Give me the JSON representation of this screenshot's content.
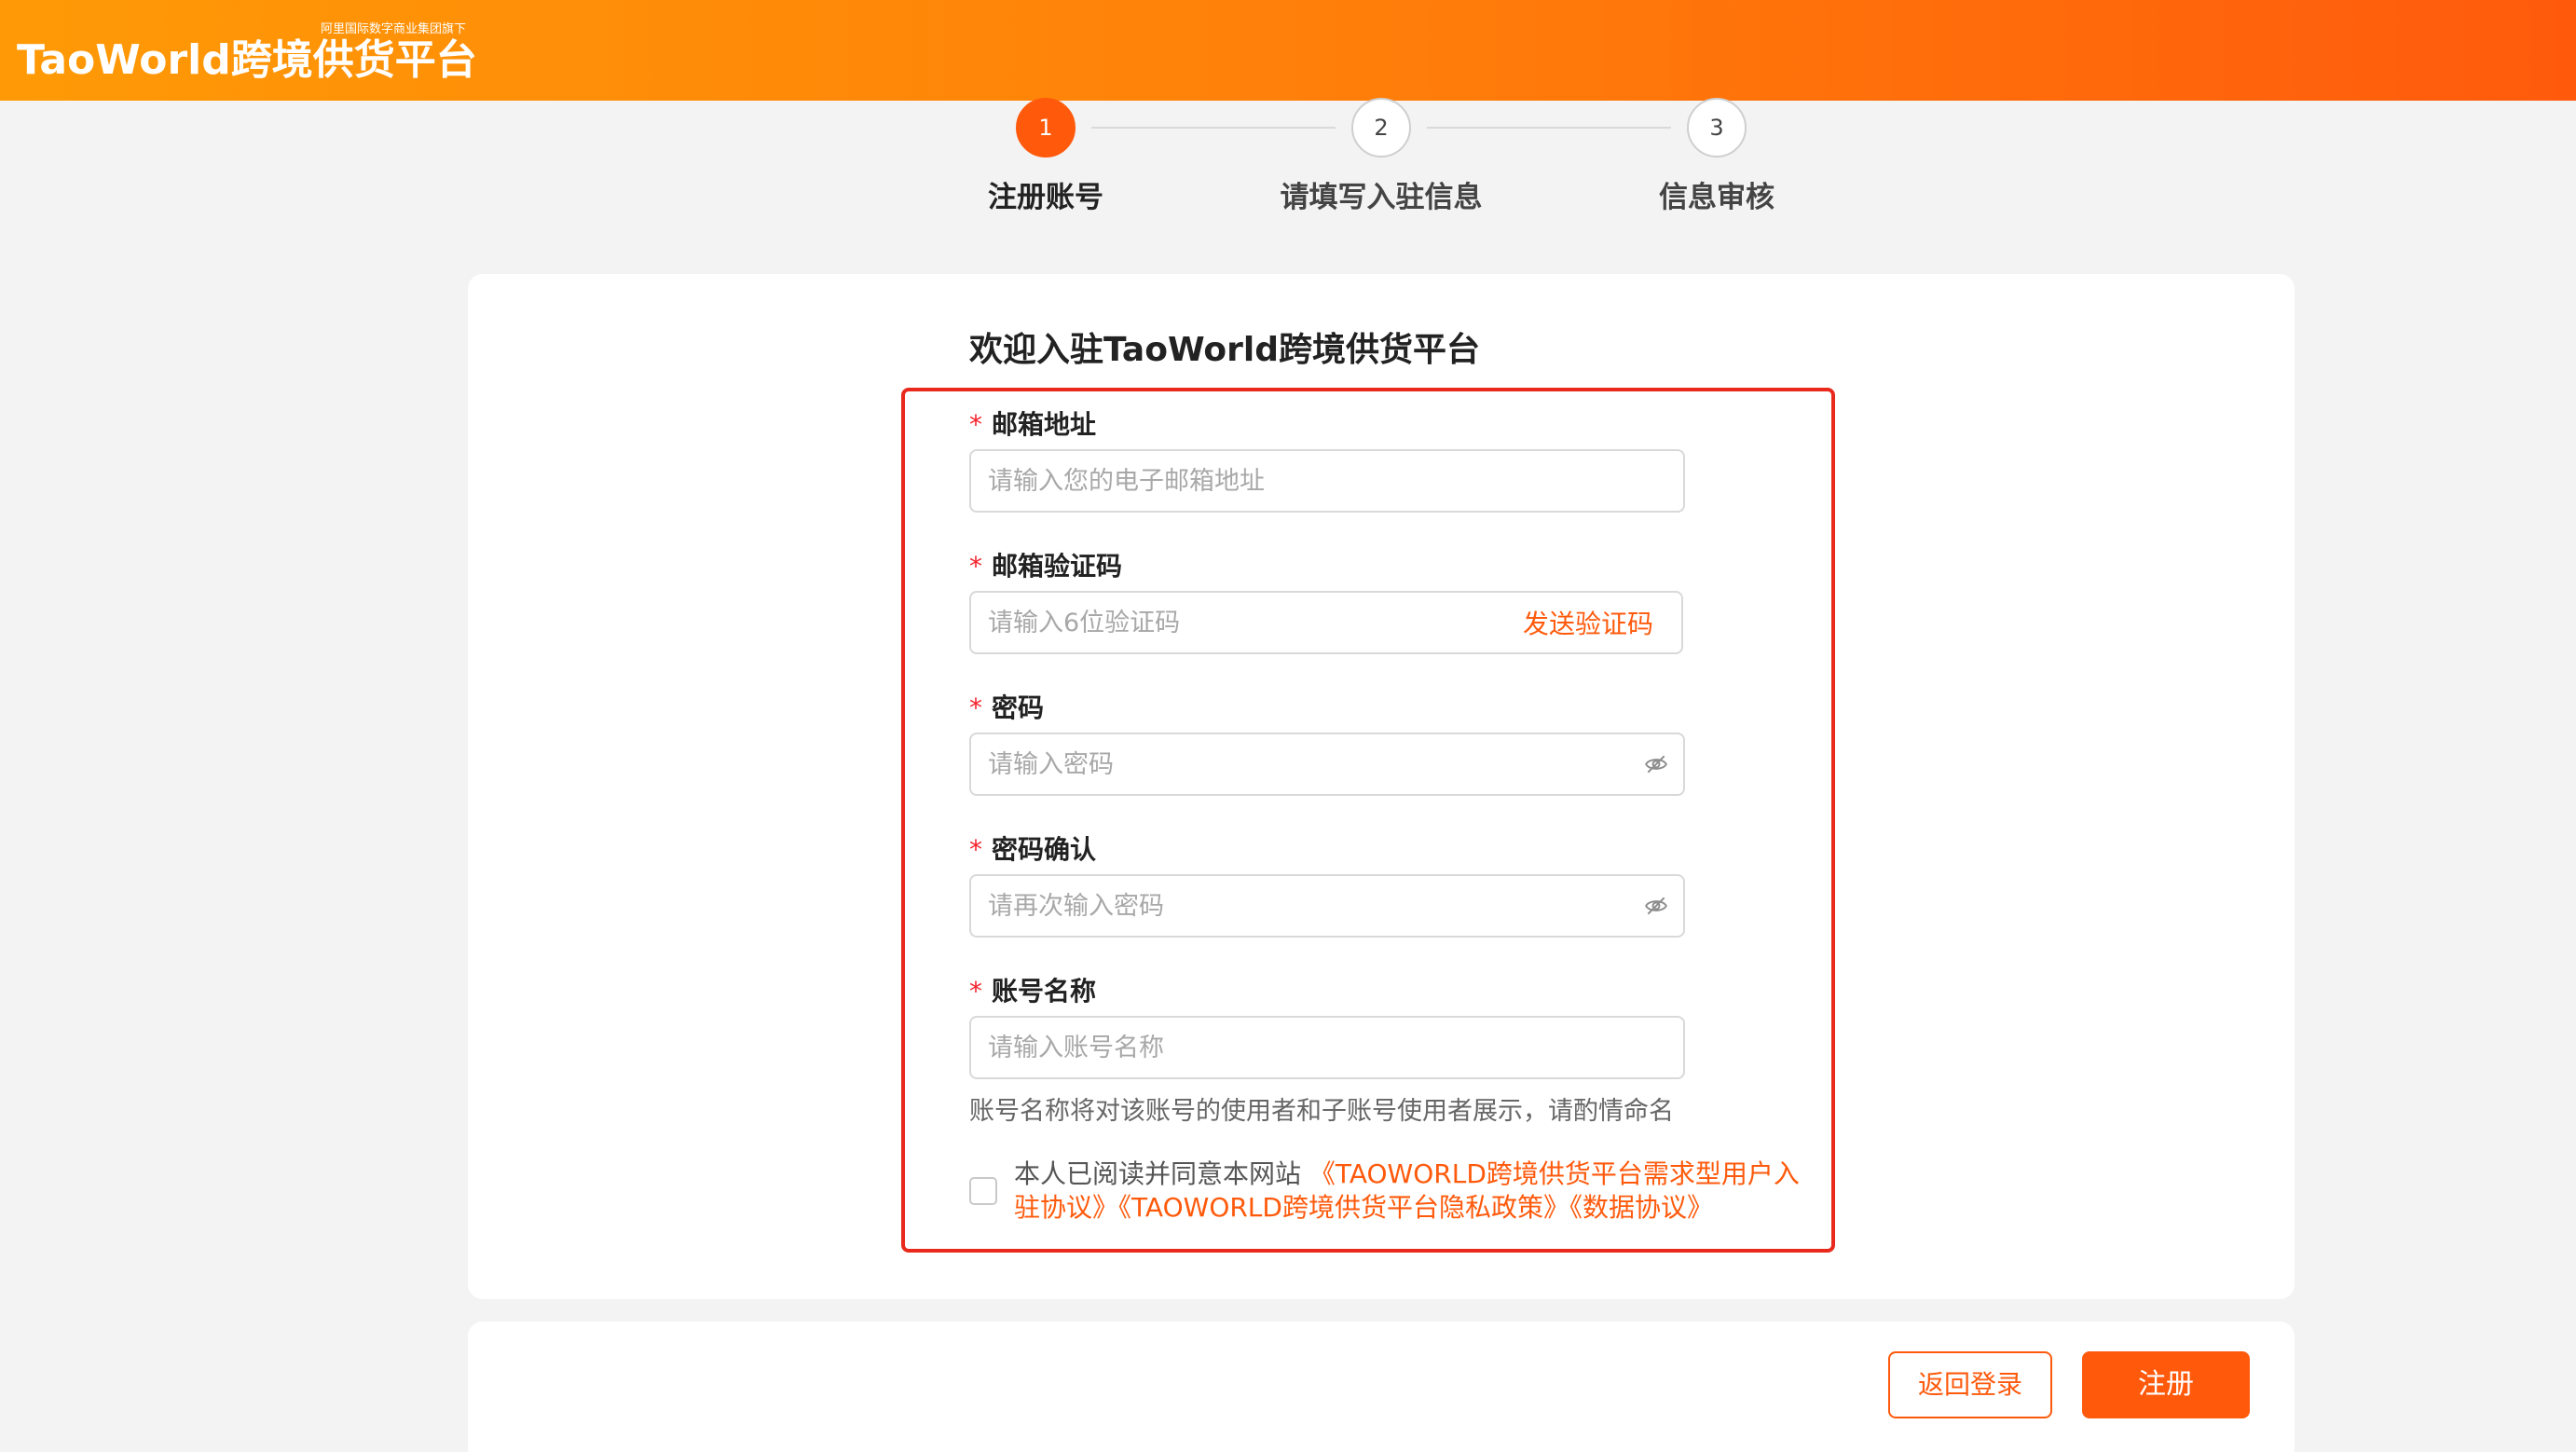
{
  "header": {
    "logo_text": "TaoWorld跨境供货平台",
    "logo_subtext": "阿里国际数字商业集团旗下"
  },
  "steps": [
    {
      "number": "1",
      "label": "注册账号",
      "active": true
    },
    {
      "number": "2",
      "label": "请填写入驻信息",
      "active": false
    },
    {
      "number": "3",
      "label": "信息审核",
      "active": false
    }
  ],
  "form": {
    "title": "欢迎入驻TaoWorld跨境供货平台",
    "required_mark": "*",
    "email": {
      "label": "邮箱地址",
      "placeholder": "请输入您的电子邮箱地址"
    },
    "code": {
      "label": "邮箱验证码",
      "placeholder": "请输入6位验证码",
      "send_label": "发送验证码"
    },
    "password": {
      "label": "密码",
      "placeholder": "请输入密码"
    },
    "password_confirm": {
      "label": "密码确认",
      "placeholder": "请再次输入密码"
    },
    "account_name": {
      "label": "账号名称",
      "placeholder": "请输入账号名称",
      "help": "账号名称将对该账号的使用者和子账号使用者展示，请酌情命名"
    },
    "agreement": {
      "prefix": "本人已阅读并同意本网站 ",
      "links": "《TAOWORLD跨境供货平台需求型用户入驻协议》《TAOWORLD跨境供货平台隐私政策》《数据协议》"
    }
  },
  "actions": {
    "back_label": "返回登录",
    "register_label": "注册"
  },
  "colors": {
    "brand": "#ff5a0c",
    "header_gradient_start": "#ff9a06",
    "header_gradient_end": "#ff5a0c",
    "highlight": "#e8291c"
  },
  "icons": {
    "password_visibility": "eye-slash-icon"
  }
}
